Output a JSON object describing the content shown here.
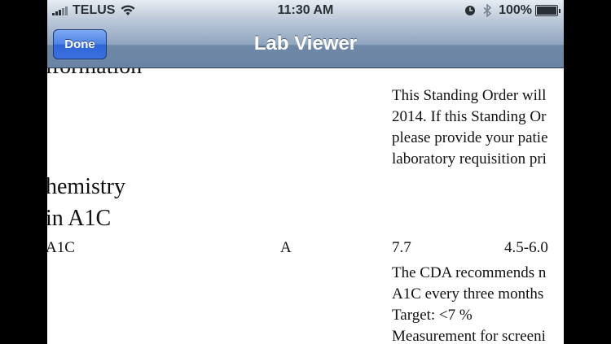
{
  "status_bar": {
    "carrier": "TELUS",
    "time": "11:30 AM",
    "battery_percent": "100%",
    "battery_level": 1.0,
    "icons": [
      "signal-bars-icon",
      "wifi-icon",
      "clock-icon",
      "bluetooth-icon",
      "battery-icon"
    ]
  },
  "nav": {
    "title": "Lab Viewer",
    "done_label": "Done"
  },
  "content": {
    "section_partial": "iformation",
    "standing_order_lines": [
      "This Standing Order will",
      "2014. If this Standing Or",
      "please provide your patie",
      "laboratory requisition pri"
    ],
    "category_heading": "hemistry",
    "test_heading": "in A1C",
    "result_row": {
      "test": "A1C",
      "flag": "A",
      "value": "7.7",
      "range": "4.5-6.0"
    },
    "comment_lines": [
      "The CDA recommends n",
      "A1C every three months",
      "Target: <7 %",
      "Measurement for screeni"
    ]
  },
  "colors": {
    "nav_gradient_top": "#b9c7d8",
    "nav_gradient_bottom": "#6a84a5",
    "done_button": "#3a70de",
    "status_bar": "#c9d3df"
  }
}
